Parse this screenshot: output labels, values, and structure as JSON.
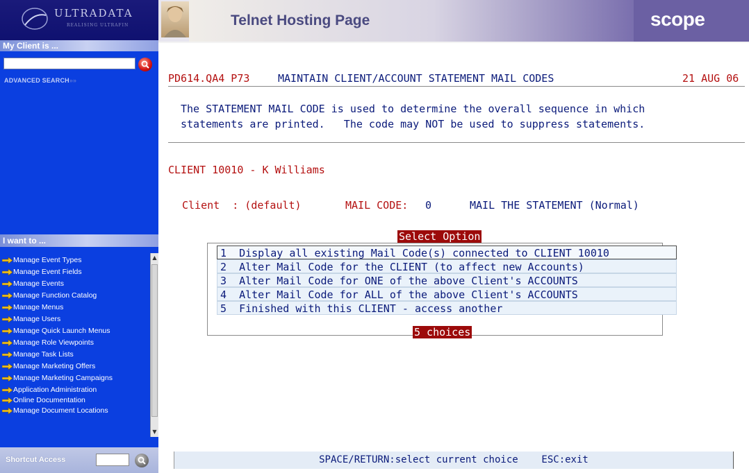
{
  "sidebar": {
    "logo_text": "ULTRADATA",
    "logo_tagline": "REALISING ULTRAFIN",
    "my_client_label": "My Client is ...",
    "search_placeholder": "",
    "advanced_search": "ADVANCED SEARCH",
    "i_want_label": "I want to ...",
    "menu_items": [
      "Manage Event Types",
      "Manage Event Fields",
      "Manage Events",
      "Manage Function Catalog",
      "Manage Menus",
      "Manage Users",
      "Manage Quick Launch Menus",
      "Manage Role Viewpoints",
      "Manage Task Lists",
      "Manage Marketing Offers",
      "Manage Marketing Campaigns",
      "Application Administration",
      "Online Documentation",
      "Manage Document Locations"
    ],
    "shortcut_label": "Shortcut Access"
  },
  "header": {
    "title": "Telnet Hosting Page",
    "brand": "scope"
  },
  "terminal": {
    "program_id": "PD614.QA4 P73",
    "screen_title": "MAINTAIN CLIENT/ACCOUNT STATEMENT MAIL CODES",
    "date": "21 AUG 06",
    "info_line1": "The STATEMENT MAIL CODE is used to determine the overall sequence in which",
    "info_line2": "statements are printed.   The code may NOT be used to suppress statements.",
    "client_line": "CLIENT 10010 - K Williams",
    "client_label": "Client  : (default)",
    "mail_code_label": "MAIL CODE:",
    "mail_code_value": "0",
    "mail_code_desc": "MAIL THE STATEMENT (Normal)",
    "select_title": "Select Option",
    "options": [
      "1  Display all existing Mail Code(s) connected to CLIENT 10010",
      "2  Alter Mail Code for the CLIENT (to affect new Accounts)",
      "3  Alter Mail Code for ONE of the above Client's ACCOUNTS",
      "4  Alter Mail Code for ALL of the above Client's ACCOUNTS",
      "5  Finished with this CLIENT - access another"
    ],
    "choices_footer": "5 choices",
    "status_bar": "SPACE/RETURN:select current choice    ESC:exit"
  },
  "colors": {
    "sidebar_bg": "#0b3fe0",
    "terminal_text": "#0a1a7a",
    "terminal_red": "#b41010",
    "highlight_red": "#9c0a0a",
    "brand_purple": "#6b60a3"
  }
}
